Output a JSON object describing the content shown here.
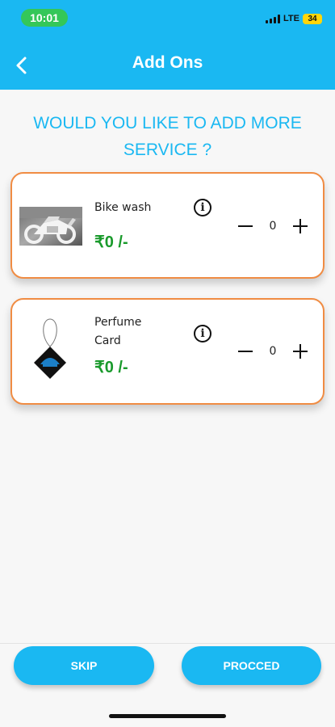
{
  "status_bar": {
    "time": "10:01",
    "network": "LTE",
    "battery": "34"
  },
  "header": {
    "title": "Add Ons",
    "back_icon": "chevron-left-icon"
  },
  "prompt": "WOULD YOU LIKE TO ADD MORE SERVICE ?",
  "addons": [
    {
      "name": "Bike wash",
      "price": "₹0 /-",
      "quantity": "0",
      "image_icon": "motorbike-photo",
      "info_icon": "info-icon"
    },
    {
      "name": "Perfume Card",
      "price": "₹0 /-",
      "quantity": "0",
      "image_icon": "air-freshener-card-photo",
      "info_icon": "info-icon"
    }
  ],
  "footer": {
    "skip_label": "SKIP",
    "proceed_label": "PROCCED"
  },
  "colors": {
    "primary": "#1ab8f2",
    "card_border": "#f08c43",
    "price": "#1a9a2c",
    "time_pill": "#34c759",
    "battery": "#ffd60a"
  }
}
